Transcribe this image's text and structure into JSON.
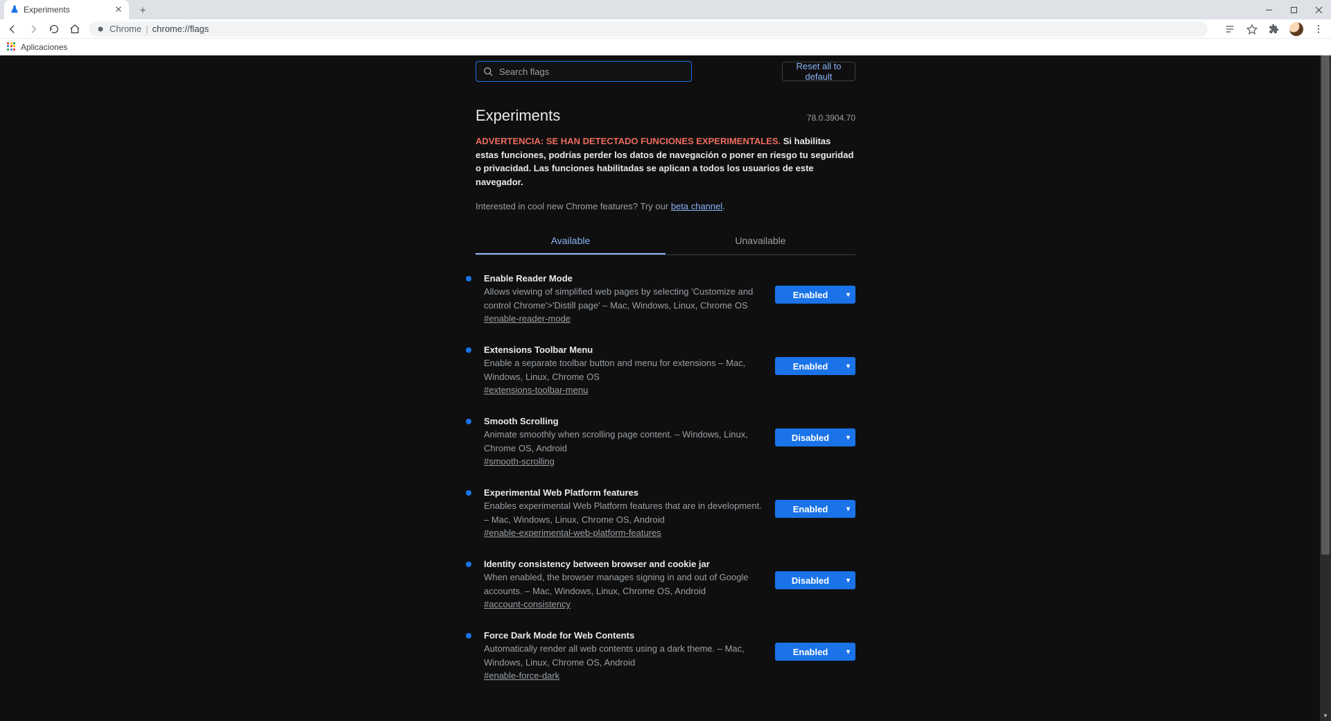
{
  "browser": {
    "tab_title": "Experiments",
    "omnibox_label": "Chrome",
    "omnibox_url": "chrome://flags",
    "bookmarks_bar": {
      "apps_label": "Aplicaciones"
    }
  },
  "page": {
    "search_placeholder": "Search flags",
    "reset_button": "Reset all to default",
    "title": "Experiments",
    "version": "78.0.3904.70",
    "warning_red": "ADVERTENCIA: SE HAN DETECTADO FUNCIONES EXPERIMENTALES.",
    "warning_rest": "Si habilitas estas funciones, podrías perder los datos de navegación o poner en riesgo tu seguridad o privacidad. Las funciones habilitadas se aplican a todos los usuarios de este navegador.",
    "beta_prefix": "Interested in cool new Chrome features? Try our ",
    "beta_link": "beta channel",
    "tabs": {
      "available": "Available",
      "unavailable": "Unavailable"
    },
    "flags": [
      {
        "title": "Enable Reader Mode",
        "desc": "Allows viewing of simplified web pages by selecting 'Customize and control Chrome'>'Distill page' – Mac, Windows, Linux, Chrome OS",
        "hash": "#enable-reader-mode",
        "state": "Enabled"
      },
      {
        "title": "Extensions Toolbar Menu",
        "desc": "Enable a separate toolbar button and menu for extensions – Mac, Windows, Linux, Chrome OS",
        "hash": "#extensions-toolbar-menu",
        "state": "Enabled"
      },
      {
        "title": "Smooth Scrolling",
        "desc": "Animate smoothly when scrolling page content. – Windows, Linux, Chrome OS, Android",
        "hash": "#smooth-scrolling",
        "state": "Disabled"
      },
      {
        "title": "Experimental Web Platform features",
        "desc": "Enables experimental Web Platform features that are in development. – Mac, Windows, Linux, Chrome OS, Android",
        "hash": "#enable-experimental-web-platform-features",
        "state": "Enabled"
      },
      {
        "title": "Identity consistency between browser and cookie jar",
        "desc": "When enabled, the browser manages signing in and out of Google accounts. – Mac, Windows, Linux, Chrome OS, Android",
        "hash": "#account-consistency",
        "state": "Disabled"
      },
      {
        "title": "Force Dark Mode for Web Contents",
        "desc": "Automatically render all web contents using a dark theme. – Mac, Windows, Linux, Chrome OS, Android",
        "hash": "#enable-force-dark",
        "state": "Enabled"
      }
    ]
  }
}
